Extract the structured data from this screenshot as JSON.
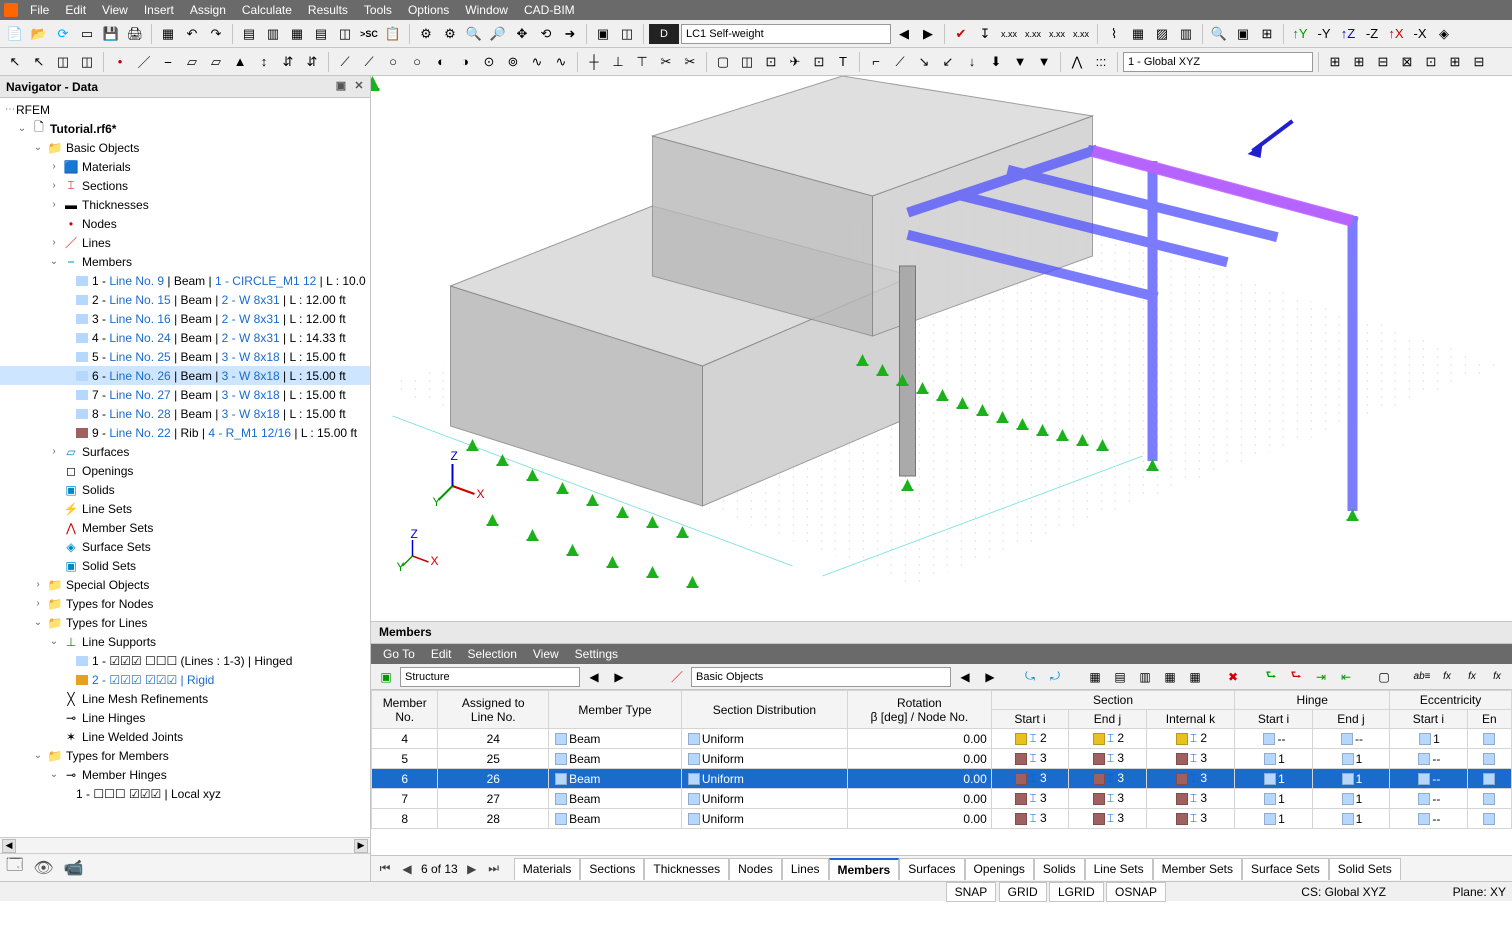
{
  "menu": [
    "File",
    "Edit",
    "View",
    "Insert",
    "Assign",
    "Calculate",
    "Results",
    "Tools",
    "Options",
    "Window",
    "CAD-BIM"
  ],
  "toolbar1_dark": "D",
  "toolbar1_combo": "LC1  Self-weight",
  "toolbar2_combo": "1 - Global XYZ",
  "navigator": {
    "title": "Navigator - Data",
    "root": "RFEM",
    "file": "Tutorial.rf6*",
    "basic": "Basic Objects",
    "items": {
      "materials": "Materials",
      "sections": "Sections",
      "thicknesses": "Thicknesses",
      "nodes": "Nodes",
      "lines": "Lines",
      "members": "Members",
      "surfaces": "Surfaces",
      "openings": "Openings",
      "solids": "Solids",
      "linesets": "Line Sets",
      "membersets": "Member Sets",
      "surfacesets": "Surface Sets",
      "solidsets": "Solid Sets"
    },
    "members_list": [
      {
        "num": "1",
        "pre": " - ",
        "line": "Line No. 9",
        "desc": " | Beam | ",
        "sec": "1 - CIRCLE_M1 12",
        "len": " | L : 10.0"
      },
      {
        "num": "2",
        "pre": " - ",
        "line": "Line No. 15",
        "desc": " | Beam | ",
        "sec": "2 - W 8x31",
        "len": " | L : 12.00 ft"
      },
      {
        "num": "3",
        "pre": " - ",
        "line": "Line No. 16",
        "desc": " | Beam | ",
        "sec": "2 - W 8x31",
        "len": " | L : 12.00 ft"
      },
      {
        "num": "4",
        "pre": " - ",
        "line": "Line No. 24",
        "desc": " | Beam | ",
        "sec": "2 - W 8x31",
        "len": " | L : 14.33 ft"
      },
      {
        "num": "5",
        "pre": " - ",
        "line": "Line No. 25",
        "desc": " | Beam | ",
        "sec": "3 - W 8x18",
        "len": " | L : 15.00 ft"
      },
      {
        "num": "6",
        "pre": " - ",
        "line": "Line No. 26",
        "desc": " | Beam | ",
        "sec": "3 - W 8x18",
        "len": " | L : 15.00 ft"
      },
      {
        "num": "7",
        "pre": " - ",
        "line": "Line No. 27",
        "desc": " | Beam | ",
        "sec": "3 - W 8x18",
        "len": " | L : 15.00 ft"
      },
      {
        "num": "8",
        "pre": " - ",
        "line": "Line No. 28",
        "desc": " | Beam | ",
        "sec": "3 - W 8x18",
        "len": " | L : 15.00 ft"
      },
      {
        "num": "9",
        "pre": " - ",
        "line": "Line No. 22",
        "desc": " | Rib | ",
        "sec": "4 - R_M1 12/16",
        "len": " | L : 15.00 ft"
      }
    ],
    "special": "Special Objects",
    "types_nodes": "Types for Nodes",
    "types_lines": "Types for Lines",
    "line_supports": "Line Supports",
    "ls1": "1 - ☑☑☑ ☐☐☐ (Lines : 1-3) | Hinged",
    "ls2": "2 - ☑☑☑ ☑☑☑ | Rigid",
    "lmr": "Line Mesh Refinements",
    "lh": "Line Hinges",
    "lwj": "Line Welded Joints",
    "types_members": "Types for Members",
    "memhinges": "Member Hinges",
    "mh1": "1 - ☐☐☐ ☑☑☑ | Local xyz"
  },
  "tablepanel": {
    "title": "Members",
    "menu": [
      "Go To",
      "Edit",
      "Selection",
      "View",
      "Settings"
    ],
    "combo_struct": "Structure",
    "combo_basic": "Basic Objects",
    "headers": {
      "member": "Member",
      "no": "No.",
      "assigned": "Assigned to",
      "linen": "Line No.",
      "mtype": "Member Type",
      "secdist": "Section Distribution",
      "rotation": "Rotation",
      "rotdesc": "β [deg] / Node No.",
      "section": "Section",
      "starti": "Start i",
      "endj": "End j",
      "internalk": "Internal k",
      "hinge": "Hinge",
      "ecc": "Eccentricity",
      "en": "En"
    },
    "rows": [
      {
        "no": "4",
        "line": "24",
        "type": "Beam",
        "dist": "Uniform",
        "rot": "0.00",
        "si": "2",
        "ej": "2",
        "ik": "2",
        "hi": "--",
        "hj": "--",
        "ei": "1",
        "sc": "#e8c020",
        "bc": "#b6d8ff"
      },
      {
        "no": "5",
        "line": "25",
        "type": "Beam",
        "dist": "Uniform",
        "rot": "0.00",
        "si": "3",
        "ej": "3",
        "ik": "3",
        "hi": "1",
        "hj": "1",
        "ei": "--",
        "sc": "#a06060",
        "bc": "#b6d8ff"
      },
      {
        "no": "6",
        "line": "26",
        "type": "Beam",
        "dist": "Uniform",
        "rot": "0.00",
        "si": "3",
        "ej": "3",
        "ik": "3",
        "hi": "1",
        "hj": "1",
        "ei": "--",
        "sc": "#a06060",
        "bc": "#b6d8ff",
        "sel": true
      },
      {
        "no": "7",
        "line": "27",
        "type": "Beam",
        "dist": "Uniform",
        "rot": "0.00",
        "si": "3",
        "ej": "3",
        "ik": "3",
        "hi": "1",
        "hj": "1",
        "ei": "--",
        "sc": "#a06060",
        "bc": "#b6d8ff"
      },
      {
        "no": "8",
        "line": "28",
        "type": "Beam",
        "dist": "Uniform",
        "rot": "0.00",
        "si": "3",
        "ej": "3",
        "ik": "3",
        "hi": "1",
        "hj": "1",
        "ei": "--",
        "sc": "#a06060",
        "bc": "#b6d8ff"
      }
    ],
    "pager": "6 of 13",
    "tabs": [
      "Materials",
      "Sections",
      "Thicknesses",
      "Nodes",
      "Lines",
      "Members",
      "Surfaces",
      "Openings",
      "Solids",
      "Line Sets",
      "Member Sets",
      "Surface Sets",
      "Solid Sets"
    ],
    "active_tab": "Members"
  },
  "status": {
    "snaps": [
      "SNAP",
      "GRID",
      "LGRID",
      "OSNAP"
    ],
    "cs": "CS: Global XYZ",
    "plane": "Plane: XY"
  }
}
